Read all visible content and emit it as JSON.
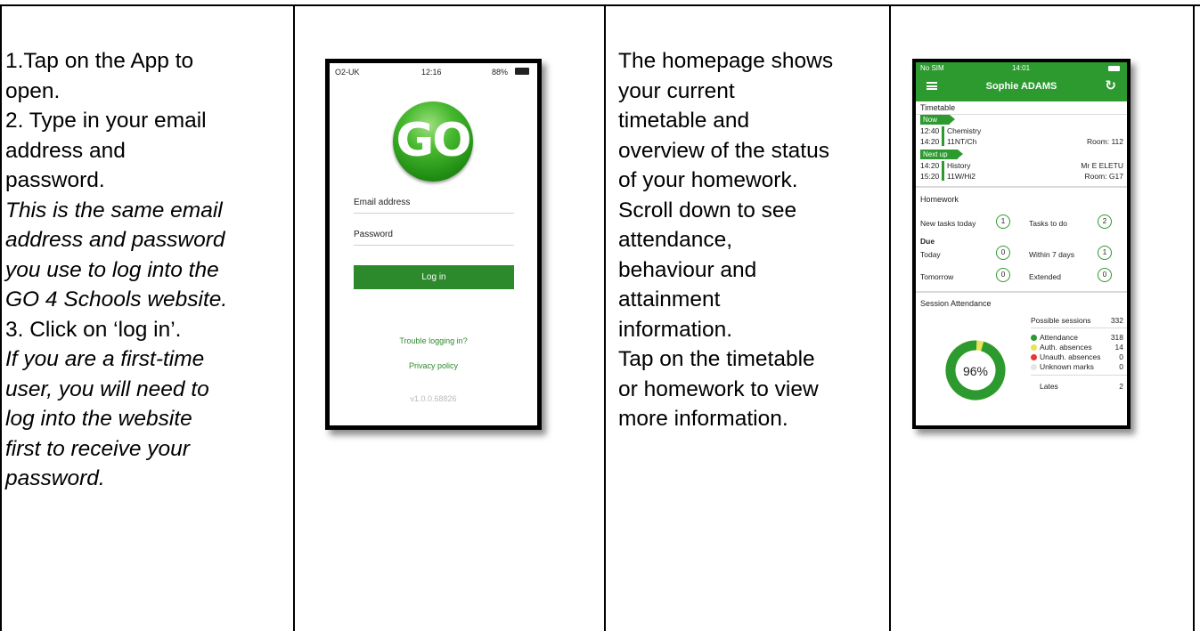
{
  "col1": {
    "lines": [
      "1.Tap on the App to",
      "open.",
      "2. Type in your email",
      "address and",
      "password."
    ],
    "italic1": [
      "This is the same email",
      "address and password",
      "you use to log into the",
      "GO 4 Schools website."
    ],
    "step3": "3. Click on ‘log in’.",
    "italic2": [
      "If you are a first-time",
      "user, you will need to",
      "log into the website",
      "first to receive your",
      "password."
    ]
  },
  "login_phone": {
    "carrier": "O2-UK",
    "time": "12:16",
    "battery": "88%",
    "logo_text": "GO",
    "email_label": "Email address",
    "password_label": "Password",
    "login_button": "Log in",
    "trouble_link": "Trouble logging in?",
    "privacy_link": "Privacy policy",
    "version": "v1.0.0.68826"
  },
  "col3": {
    "lines": [
      "The homepage shows",
      "your current",
      "timetable and",
      "overview of the status",
      "of your homework.",
      "Scroll down to see",
      "attendance,",
      "behaviour and",
      "attainment",
      "information.",
      "Tap on the timetable",
      "or homework to view",
      "more information."
    ]
  },
  "home_phone": {
    "carrier": "No SIM",
    "time": "14:01",
    "user_name": "Sophie ADAMS",
    "timetable_title": "Timetable",
    "now_tag": "Now",
    "now_start": "12:40",
    "now_end": "14:20",
    "now_subject": "Chemistry",
    "now_class": "11NT/Ch",
    "now_room": "Room: 112",
    "next_tag": "Next up",
    "next_start": "14:20",
    "next_end": "15:20",
    "next_subject": "History",
    "next_class": "11W/Hi2",
    "next_teacher": "Mr E ELETU",
    "next_room": "Room: G17",
    "homework_title": "Homework",
    "new_tasks_label": "New tasks today",
    "new_tasks_value": "1",
    "tasks_todo_label": "Tasks to do",
    "tasks_todo_value": "2",
    "due_label": "Due",
    "today_label": "Today",
    "today_value": "0",
    "within7_label": "Within 7 days",
    "within7_value": "1",
    "tomorrow_label": "Tomorrow",
    "tomorrow_value": "0",
    "extended_label": "Extended",
    "extended_value": "0",
    "attendance_title": "Session Attendance",
    "percent": "96%",
    "attendance_fraction": 0.96,
    "possible_label": "Possible sessions",
    "possible_value": "332",
    "attendance_label": "Attendance",
    "attendance_value": "318",
    "auth_label": "Auth. absences",
    "auth_value": "14",
    "unauth_label": "Unauth. absences",
    "unauth_value": "0",
    "unknown_label": "Unknown marks",
    "unknown_value": "0",
    "lates_label": "Lates",
    "lates_value": "2",
    "colors": {
      "green": "#2c9a2f",
      "yellow": "#e8e35a",
      "red": "#e53935",
      "grey": "#e6e6e6"
    }
  }
}
